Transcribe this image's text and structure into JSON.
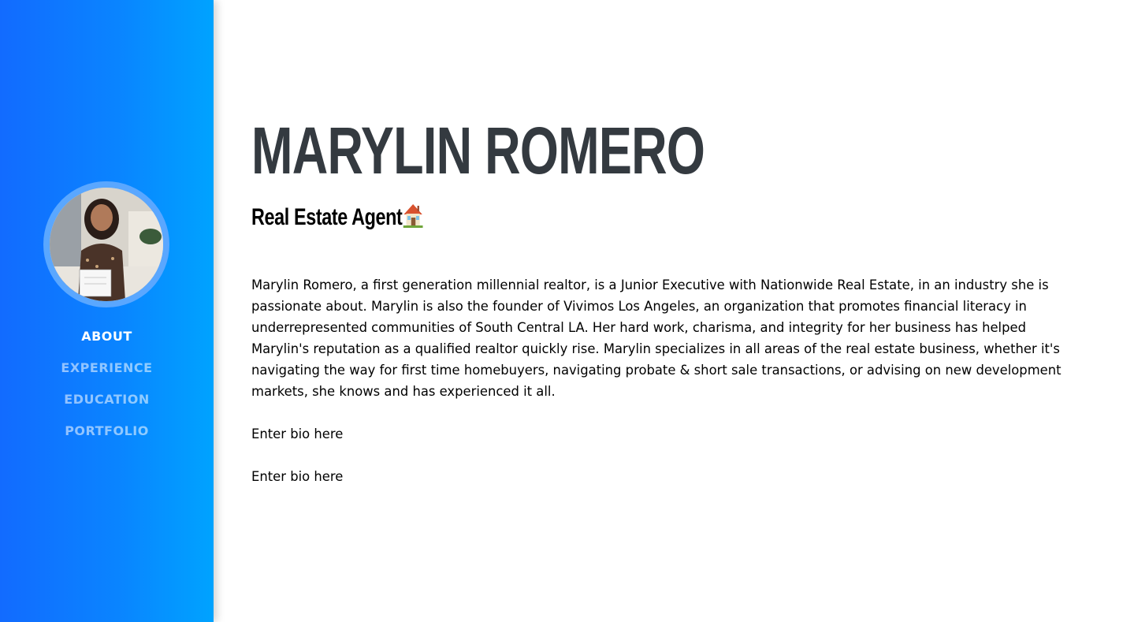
{
  "sidebar": {
    "avatar_alt": "Marylin Romero profile photo",
    "accent": "#126bff",
    "nav": [
      {
        "label": "ABOUT",
        "active": true
      },
      {
        "label": "EXPERIENCE",
        "active": false
      },
      {
        "label": "EDUCATION",
        "active": false
      },
      {
        "label": "PORTFOLIO",
        "active": false
      }
    ]
  },
  "main": {
    "name": "MARYLIN ROMERO",
    "subtitle": "Real Estate Agent",
    "subtitle_icon": "house-icon",
    "bio": [
      "Marylin Romero, a first generation millennial realtor, is a Junior Executive with Nationwide Real Estate, in an industry she is passionate about. Marylin is also the founder of Vivimos Los Angeles, an organization that promotes financial literacy in underrepresented communities of South Central LA. Her hard work, charisma, and integrity for her business has helped Marylin's reputation as a qualified realtor quickly rise. Marylin specializes in all areas of the real estate business, whether it's navigating the way for first time homebuyers, navigating probate & short sale transactions, or advising on new development markets, she knows and has experienced it all.",
      "Enter bio here",
      "Enter bio here"
    ]
  }
}
